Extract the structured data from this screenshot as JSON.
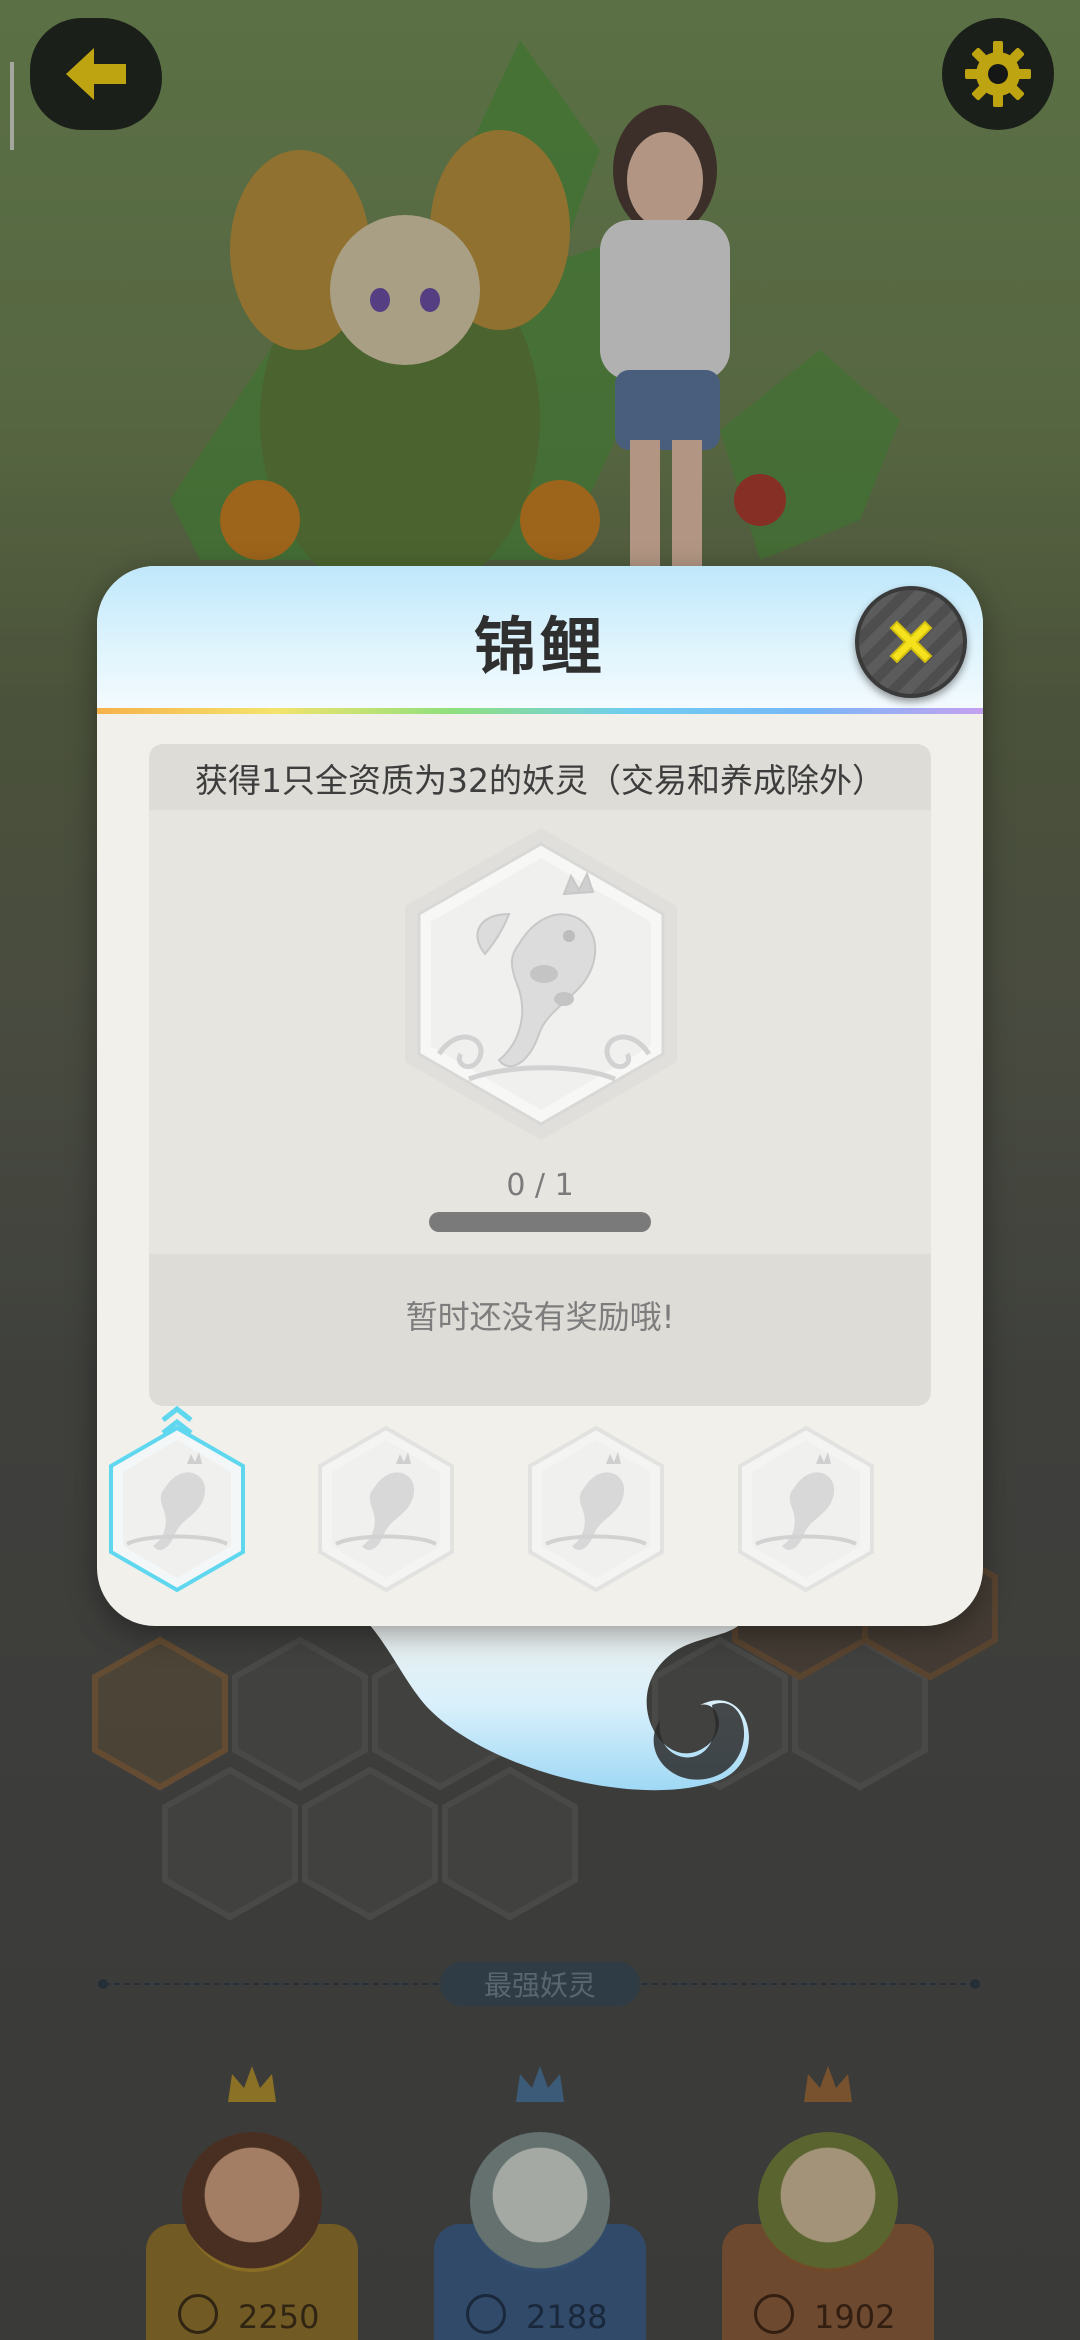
{
  "header": {
    "back_icon": "arrow-left-icon",
    "settings_icon": "gear-icon"
  },
  "dialog": {
    "title": "锦鲤",
    "close_icon": "close-x-icon",
    "description": "获得1只全资质为32的妖灵（交易和养成除外）",
    "badge_icon": "koi-fish-icon",
    "progress": {
      "current": 0,
      "total": 1,
      "text": "0 / 1"
    },
    "reward_text": "暂时还没有奖励哦!",
    "tiers": [
      {
        "icon": "koi-fish-icon",
        "selected": true
      },
      {
        "icon": "koi-fish-icon",
        "selected": false
      },
      {
        "icon": "koi-fish-icon",
        "selected": false
      },
      {
        "icon": "koi-fish-icon",
        "selected": false
      }
    ]
  },
  "ranking": {
    "title": "最强妖灵",
    "entries": [
      {
        "rank": 1,
        "crown": "gold-crown-icon",
        "score": "2250",
        "color": "#9a7a2c"
      },
      {
        "rank": 2,
        "crown": "blue-crown-icon",
        "score": "2188",
        "color": "#3e5f86"
      },
      {
        "rank": 3,
        "crown": "bronze-crown-icon",
        "score": "1902",
        "color": "#8c5a33"
      }
    ]
  },
  "colors": {
    "accent_yellow": "#f5d51c",
    "selected_tier": "#5fd7ef",
    "dialog_bg": "#f1f0eb"
  }
}
